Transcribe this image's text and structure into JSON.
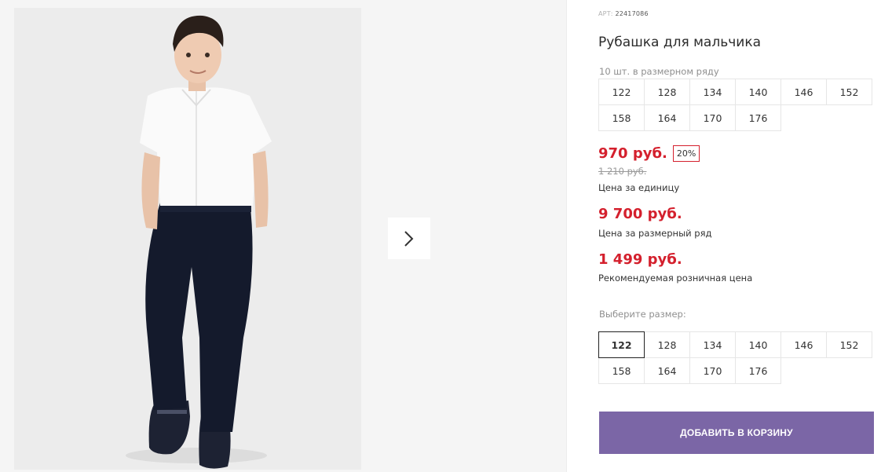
{
  "product": {
    "article_label": "АРТ:",
    "article_number": "22417086",
    "title": "Рубашка для мальчика",
    "row_note": "10 шт. в размерном ряду",
    "size_row": [
      "122",
      "128",
      "134",
      "140",
      "146",
      "152",
      "158",
      "164",
      "170",
      "176"
    ],
    "price": "970 руб.",
    "discount": "20%",
    "old_price": "1 210 руб.",
    "unit_price_label": "Цена за единицу",
    "row_price": "9 700 руб.",
    "row_price_label": "Цена за размерный ряд",
    "retail_price": "1 499 руб.",
    "retail_price_label": "Рекомендуемая розничная цена",
    "choose_size_label": "Выберите размер:",
    "size_options": [
      "122",
      "128",
      "134",
      "140",
      "146",
      "152",
      "158",
      "164",
      "170",
      "176"
    ],
    "selected_size": "122",
    "add_to_cart": "ДОБАВИТЬ В КОРЗИНУ"
  },
  "gallery": {
    "next_icon": "chevron-right-icon"
  },
  "colors": {
    "price_red": "#d4202d",
    "button_purple": "#7b66a6"
  }
}
